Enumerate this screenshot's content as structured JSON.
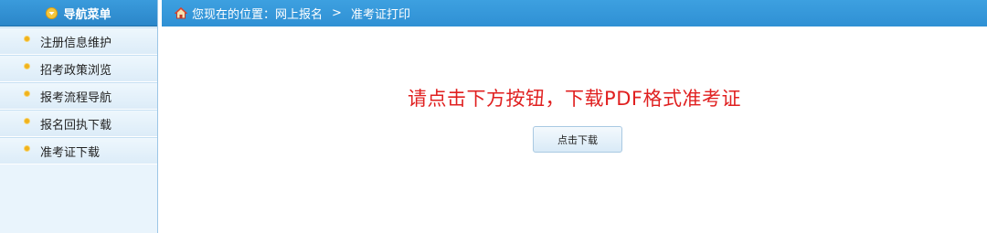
{
  "sidebar": {
    "title": "导航菜单",
    "items": [
      {
        "label": "注册信息维护"
      },
      {
        "label": "招考政策浏览"
      },
      {
        "label": "报考流程导航"
      },
      {
        "label": "报名回执下载"
      },
      {
        "label": "准考证下载"
      }
    ]
  },
  "breadcrumb": {
    "prefix": "您现在的位置：",
    "parent": "网上报名",
    "separator": ">",
    "current": "准考证打印"
  },
  "main": {
    "notice": "请点击下方按钮，下载PDF格式准考证",
    "button_label": "点击下载"
  },
  "colors": {
    "accent_blue": "#2f90d4",
    "notice_red": "#e02020",
    "bullet_gold": "#f0b21c"
  }
}
